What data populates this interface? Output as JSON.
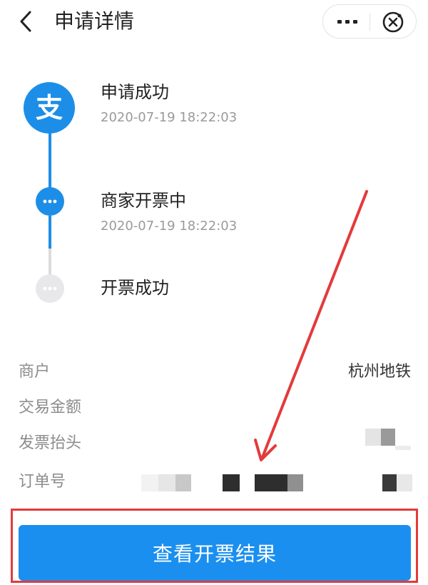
{
  "header": {
    "title": "申请详情",
    "back_icon": "chevron-left-icon",
    "more_icon": "more-dots-icon",
    "close_icon": "mini-program-close-icon"
  },
  "timeline": {
    "steps": [
      {
        "title": "申请成功",
        "time": "2020-07-19 18:22:03",
        "state": "done",
        "icon": "alipay-logo-icon",
        "icon_glyph": "支"
      },
      {
        "title": "商家开票中",
        "time": "2020-07-19 18:22:03",
        "state": "active",
        "icon": "ellipsis-icon"
      },
      {
        "title": "开票成功",
        "time": "",
        "state": "pending",
        "icon": "ellipsis-icon"
      }
    ]
  },
  "details": {
    "rows": [
      {
        "label": "商户",
        "value": "杭州地铁"
      },
      {
        "label": "交易金额",
        "value": ""
      },
      {
        "label": "发票抬头",
        "value": ""
      },
      {
        "label": "订单号",
        "value": ""
      }
    ]
  },
  "action": {
    "button_label": "查看开票结果"
  },
  "colors": {
    "accent": "#1a8ff0",
    "timeline_active": "#1d8ee8",
    "timeline_pending": "#dcdcdc",
    "annotation_red": "#e43a3a",
    "muted_text": "#9a9a9a"
  }
}
